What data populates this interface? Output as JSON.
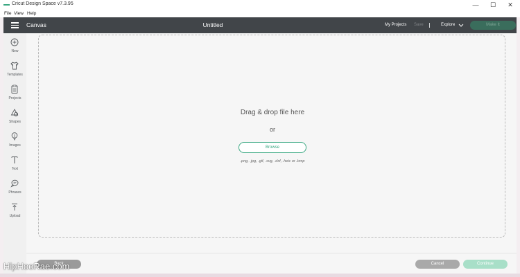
{
  "window": {
    "title": "Cricut Design Space  v7.3.95",
    "minimize_symbol": "—",
    "maximize_symbol": "☐",
    "close_symbol": "✕"
  },
  "menu": {
    "items": [
      "File",
      "View",
      "Help"
    ]
  },
  "header": {
    "menu_icon": "hamburger-icon",
    "section": "Canvas",
    "document_title": "Untitled",
    "my_projects": "My Projects",
    "save": "Save",
    "explore": "Explore",
    "make_it": "Make It",
    "colors": {
      "bar": "#414549",
      "make_it": "#3a6d5c"
    }
  },
  "sidebar": {
    "items": [
      {
        "label": "New",
        "icon": "plus-circle-icon"
      },
      {
        "label": "Templates",
        "icon": "shirt-icon"
      },
      {
        "label": "Projects",
        "icon": "clipboard-icon"
      },
      {
        "label": "Shapes",
        "icon": "shapes-icon"
      },
      {
        "label": "Images",
        "icon": "lightbulb-icon"
      },
      {
        "label": "Text",
        "icon": "text-icon"
      },
      {
        "label": "Phrases",
        "icon": "speech-bubble-icon"
      },
      {
        "label": "Upload",
        "icon": "upload-icon"
      }
    ]
  },
  "upload": {
    "drag_text": "Drag & drop file here",
    "or_text": "or",
    "browse": "Browse",
    "formats": ".png, .jpg, .gif, .svg, .dxf, .heic or .bmp",
    "colors": {
      "accent": "#3aa882"
    }
  },
  "footer": {
    "back": "Back",
    "cancel": "Cancel",
    "continue": "Continue"
  },
  "watermark": "HipHooRae.com"
}
